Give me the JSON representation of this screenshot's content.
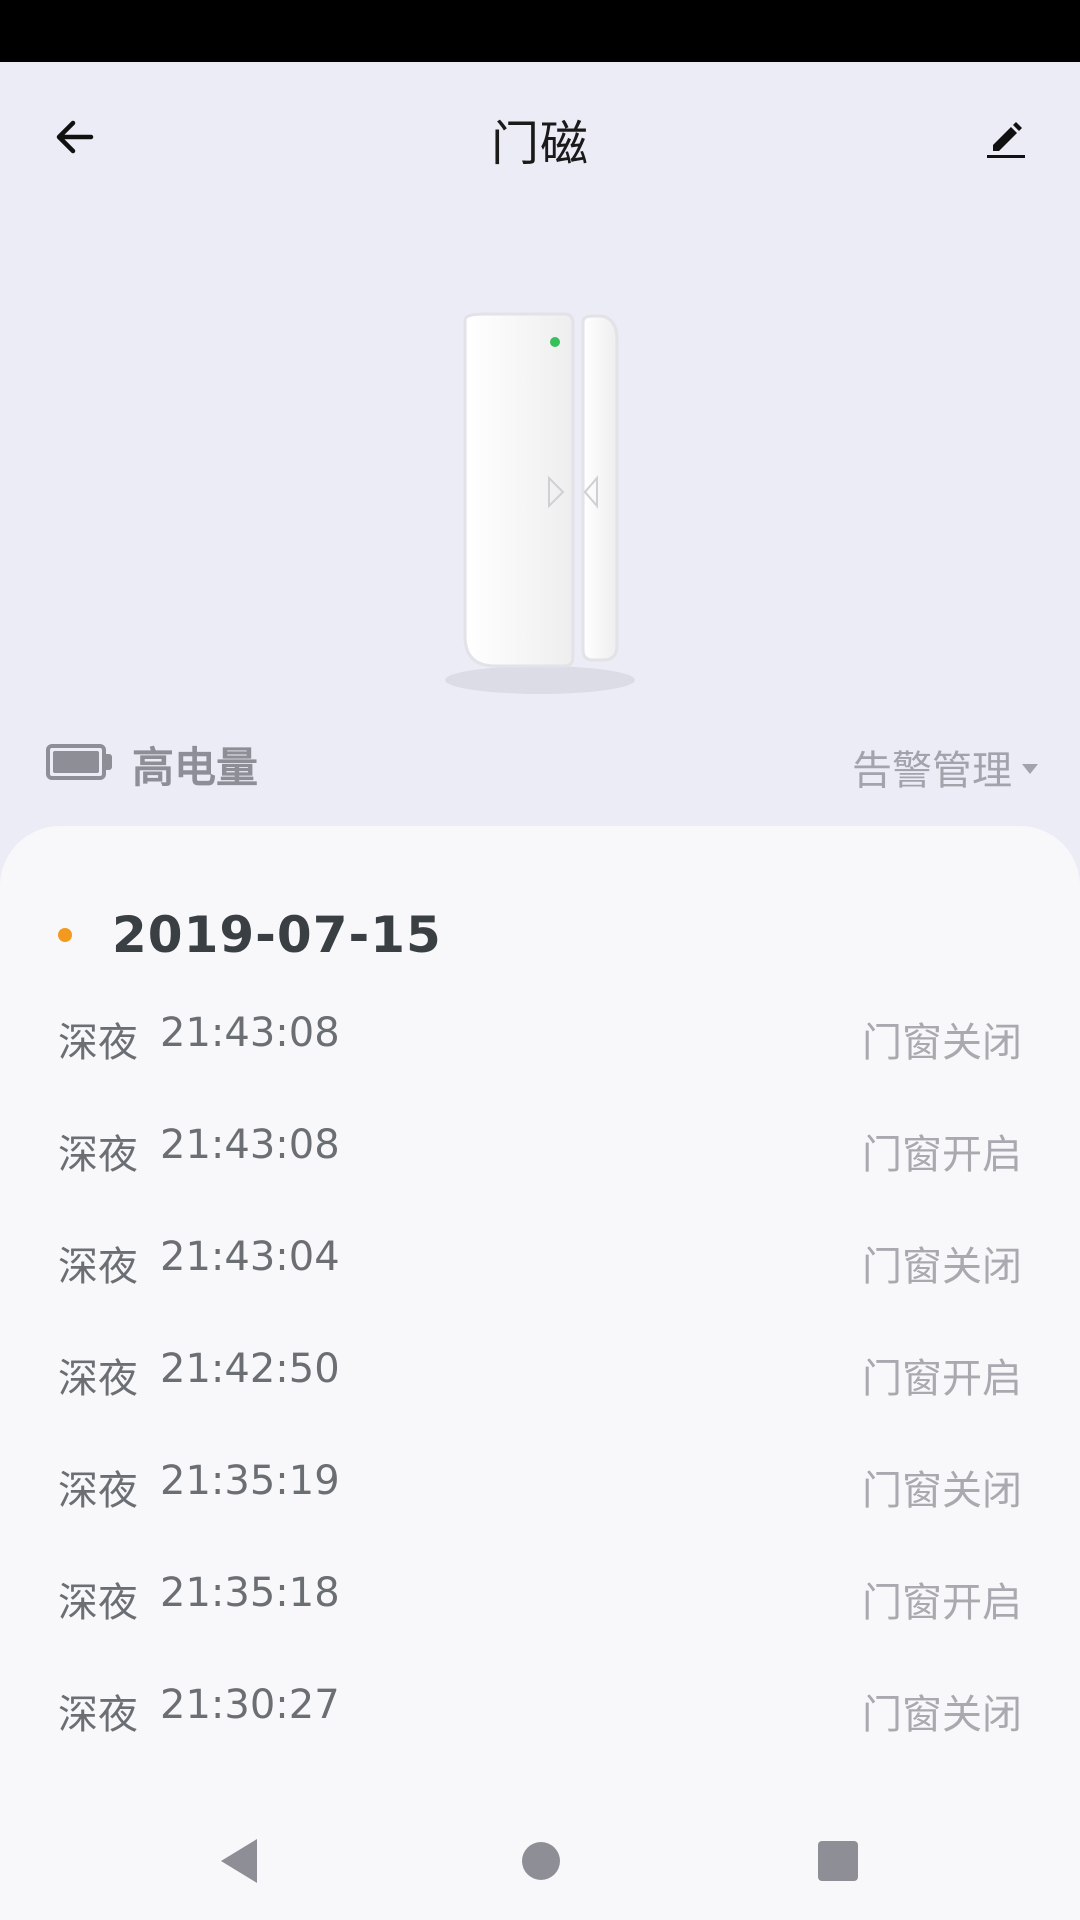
{
  "app_bar": {
    "title": "门磁",
    "back_icon": "arrow-left-icon",
    "edit_icon": "pencil-icon"
  },
  "device": {
    "image": "door-sensor-image",
    "led_color": "#36c15a"
  },
  "status": {
    "battery_label": "高电量",
    "alarm_label": "告警管理"
  },
  "log": {
    "date": "2019-07-15",
    "date_dot_color": "#f39a1e",
    "items": [
      {
        "period": "深夜",
        "time": "21:43:08",
        "event": "门窗关闭"
      },
      {
        "period": "深夜",
        "time": "21:43:08",
        "event": "门窗开启"
      },
      {
        "period": "深夜",
        "time": "21:43:04",
        "event": "门窗关闭"
      },
      {
        "period": "深夜",
        "time": "21:42:50",
        "event": "门窗开启"
      },
      {
        "period": "深夜",
        "time": "21:35:19",
        "event": "门窗关闭"
      },
      {
        "period": "深夜",
        "time": "21:35:18",
        "event": "门窗开启"
      },
      {
        "period": "深夜",
        "time": "21:30:27",
        "event": "门窗关闭"
      }
    ]
  },
  "nav": {
    "back_icon": "nav-back-icon",
    "home_icon": "nav-home-icon",
    "recent_icon": "nav-recent-icon"
  }
}
